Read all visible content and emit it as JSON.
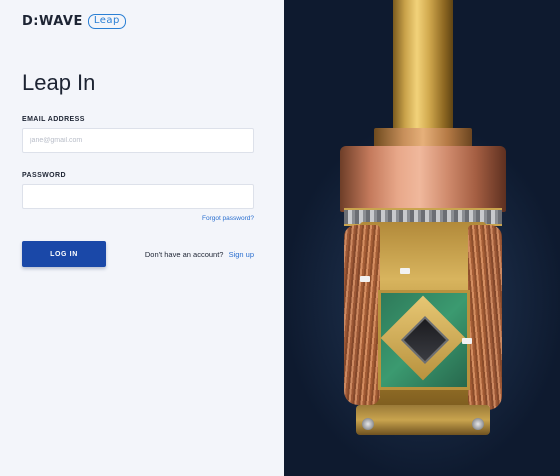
{
  "brand": {
    "wordmark": "D:WAVE",
    "product": "Leap"
  },
  "login": {
    "title": "Leap In",
    "email": {
      "label": "EMAIL ADDRESS",
      "placeholder": "jane@gmail.com",
      "value": ""
    },
    "password": {
      "label": "PASSWORD",
      "value": ""
    },
    "forgot_label": "Forgot password?",
    "login_button_label": "LOG IN",
    "signup_prompt": "Don't have an account?",
    "signup_link_label": "Sign up"
  },
  "colors": {
    "accent": "#1a48a8",
    "link": "#2a6fd0",
    "logo_badge": "#2a7fd4",
    "panel_bg": "#f3f5fa",
    "hero_bg": "#0e1a2f"
  },
  "hero": {
    "image": "quantum-processor-hardware"
  }
}
